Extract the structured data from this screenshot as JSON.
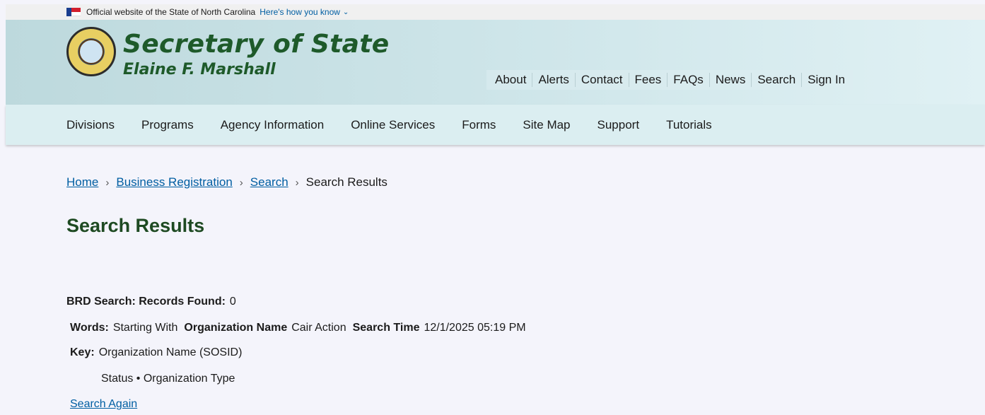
{
  "banner": {
    "official_text": "Official website of the State of North Carolina",
    "how_link": "Here's how you know",
    "flag_icon": "nc-flag-icon",
    "chevron_icon": "chevron-down-icon"
  },
  "header": {
    "title": "Secretary of State",
    "subtitle": "Elaine F. Marshall",
    "seal_icon": "nc-seal-icon",
    "utility_nav": [
      "About",
      "Alerts",
      "Contact",
      "Fees",
      "FAQs",
      "News",
      "Search",
      "Sign In"
    ]
  },
  "main_nav": [
    "Divisions",
    "Programs",
    "Agency Information",
    "Online Services",
    "Forms",
    "Site Map",
    "Support",
    "Tutorials"
  ],
  "breadcrumb": {
    "items": [
      "Home",
      "Business Registration",
      "Search"
    ],
    "current": "Search Results",
    "separator": "›"
  },
  "page_title": "Search Results",
  "results": {
    "records_label": "BRD Search: Records Found:",
    "records_count": "0",
    "words_label": "Words:",
    "words_value": "Starting With",
    "org_label": "Organization Name",
    "org_value": "Cair Action",
    "time_label": "Search Time",
    "time_value": "12/1/2025 05:19 PM",
    "key_label": "Key:",
    "key_value": "Organization Name (SOSID)",
    "key_sub": "Status • Organization Type",
    "search_again": "Search Again"
  },
  "colors": {
    "link": "#005ea2",
    "title_green": "#1e5a2a",
    "header_bg": "#cfe6ea",
    "nav_bg": "#dbeef1",
    "page_bg": "#f4f4fb"
  }
}
